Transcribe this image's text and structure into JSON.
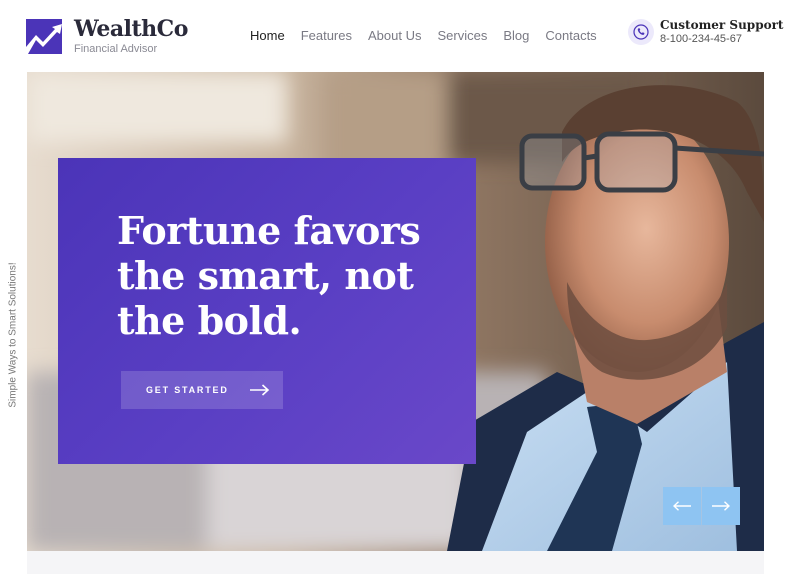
{
  "brand": {
    "name": "WealthCo",
    "tagline": "Financial Advisor",
    "accent_color": "#4b34b8"
  },
  "nav": {
    "items": [
      {
        "label": "Home",
        "active": true
      },
      {
        "label": "Features",
        "active": false
      },
      {
        "label": "About Us",
        "active": false
      },
      {
        "label": "Services",
        "active": false
      },
      {
        "label": "Blog",
        "active": false
      },
      {
        "label": "Contacts",
        "active": false
      }
    ]
  },
  "support": {
    "title": "Customer Support",
    "phone": "8-100-234-45-67",
    "icon": "phone-icon"
  },
  "hero": {
    "headline": "Fortune favors the smart, not the bold.",
    "cta_label": "GET STARTED",
    "cta_icon": "arrow-right-icon",
    "prev_icon": "arrow-left-icon",
    "next_icon": "arrow-right-icon",
    "arrow_color": "#8ec4f2",
    "image": "businessman-with-glasses-photo"
  },
  "side_text": "Simple Ways to Smart Solutions!"
}
